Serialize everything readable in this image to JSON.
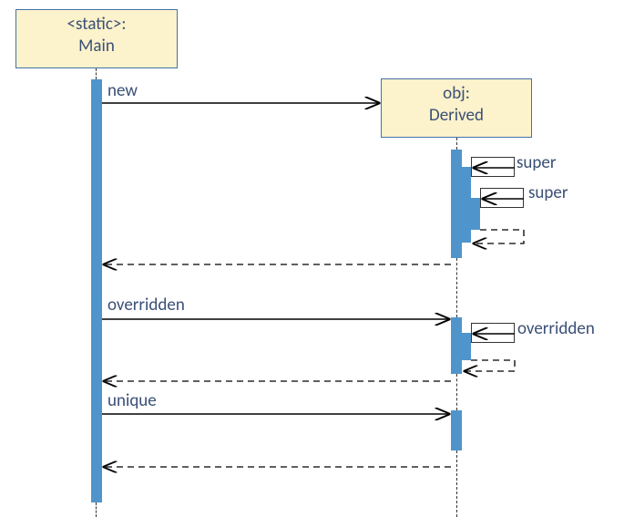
{
  "participants": {
    "main": {
      "line1": "<static>:",
      "line2": "Main"
    },
    "obj": {
      "line1": "obj:",
      "line2": "Derived"
    }
  },
  "messages": {
    "new": "new",
    "super1": "super",
    "super2": "super",
    "overridden1": "overridden",
    "overridden2": "overridden",
    "unique": "unique"
  },
  "chart_data": {
    "type": "sequence-diagram",
    "participants": [
      {
        "id": "Main",
        "label": "<static>: Main"
      },
      {
        "id": "Derived",
        "label": "obj: Derived"
      }
    ],
    "interactions": [
      {
        "from": "Main",
        "to": "Derived",
        "label": "new",
        "kind": "create"
      },
      {
        "from": "Derived",
        "to": "Derived",
        "label": "super",
        "kind": "self-call"
      },
      {
        "from": "Derived",
        "to": "Derived",
        "label": "super",
        "kind": "self-call"
      },
      {
        "from": "Derived",
        "to": "Main",
        "label": "",
        "kind": "return"
      },
      {
        "from": "Main",
        "to": "Derived",
        "label": "overridden",
        "kind": "sync-call"
      },
      {
        "from": "Derived",
        "to": "Derived",
        "label": "overridden",
        "kind": "self-call"
      },
      {
        "from": "Derived",
        "to": "Main",
        "label": "",
        "kind": "return"
      },
      {
        "from": "Main",
        "to": "Derived",
        "label": "unique",
        "kind": "sync-call"
      },
      {
        "from": "Derived",
        "to": "Main",
        "label": "",
        "kind": "return"
      }
    ]
  }
}
